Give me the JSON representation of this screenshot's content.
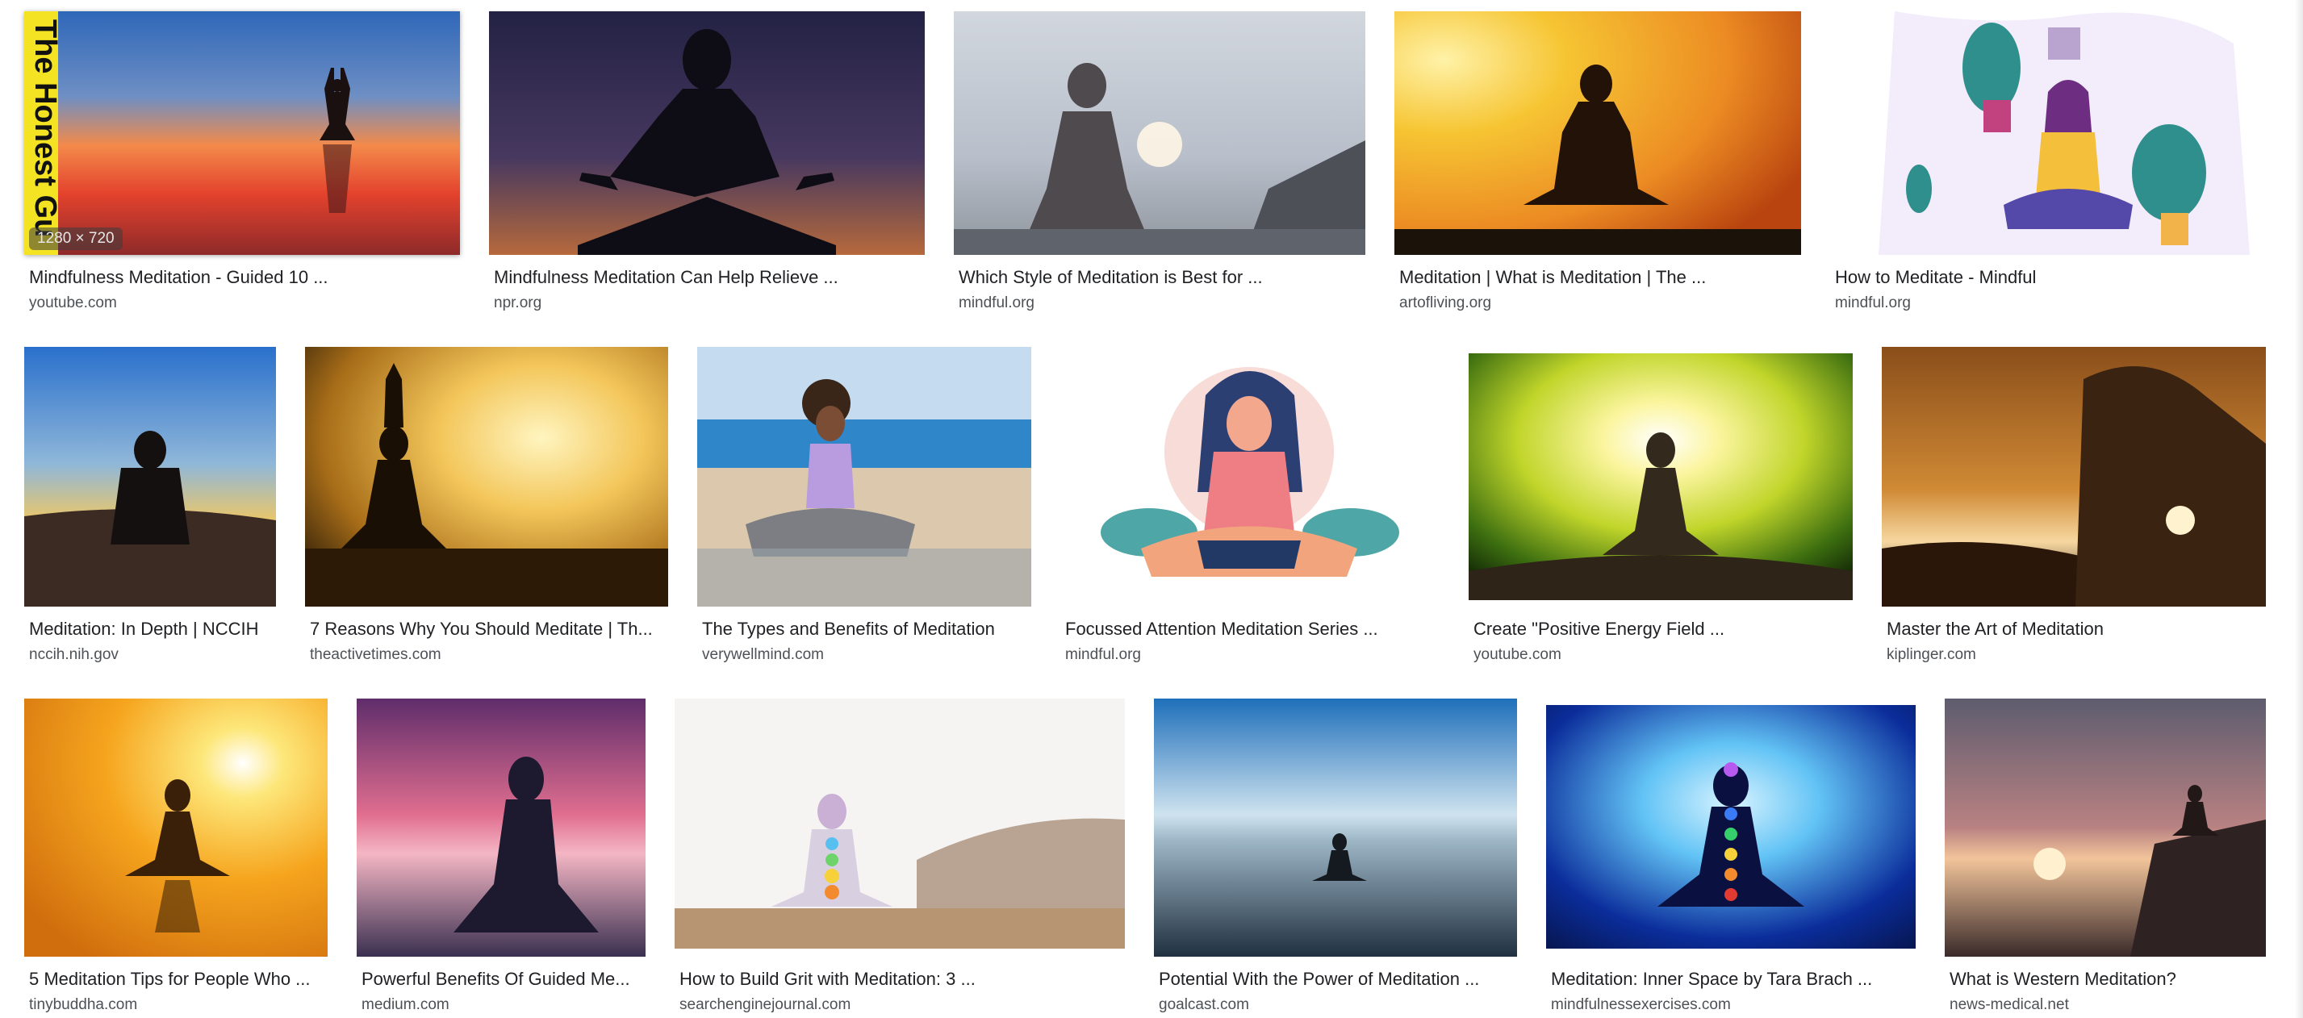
{
  "results": [
    {
      "title": "Mindfulness Meditation - Guided 10 ...",
      "source": "youtube.com",
      "dimensions": "1280 × 720",
      "overlay_text": "The Honest Gu",
      "palette": [
        "#3b6fb7",
        "#f18a4b",
        "#e2422e"
      ],
      "icon": "sitting-meditator-sunset-lake"
    },
    {
      "title": "Mindfulness Meditation Can Help Relieve ...",
      "source": "npr.org",
      "palette": [
        "#232244",
        "#4b3a62",
        "#a2613f"
      ],
      "icon": "silhouette-meditator"
    },
    {
      "title": "Which Style of Meditation is Best for ...",
      "source": "mindful.org",
      "palette": [
        "#c7cfd9",
        "#b9c0cb",
        "#5c6067"
      ],
      "icon": "woman-back-sea"
    },
    {
      "title": "Meditation | What is Meditation | The ...",
      "source": "artofliving.org",
      "palette": [
        "#f6c533",
        "#ec8b23",
        "#c74f12"
      ],
      "icon": "silhouette-meditator-sunrise"
    },
    {
      "title": "How to Meditate - Mindful",
      "source": "mindful.org",
      "palette": [
        "#ffffff",
        "#f3ecfb",
        "#7b4fa3"
      ],
      "icon": "illustration-woman-plants"
    },
    {
      "title": "Meditation: In Depth | NCCIH",
      "source": "nccih.nih.gov",
      "palette": [
        "#3b7fd4",
        "#f7c95b",
        "#2b2a2a"
      ],
      "icon": "man-back-sunset"
    },
    {
      "title": "7 Reasons Why You Should Meditate | Th...",
      "source": "theactivetimes.com",
      "palette": [
        "#f3c65a",
        "#bb7f1d",
        "#352309"
      ],
      "icon": "raised-arms-meditator"
    },
    {
      "title": "The Types and Benefits of Meditation",
      "source": "verywellmind.com",
      "palette": [
        "#b8d3ec",
        "#2f86c8",
        "#ddc9ae"
      ],
      "icon": "woman-beach-meditating"
    },
    {
      "title": "Focussed Attention Meditation Series ...",
      "source": "mindful.org",
      "palette": [
        "#ffffff",
        "#f4d5d3",
        "#4fa6a6"
      ],
      "icon": "illustration-woman-lotus"
    },
    {
      "title": "Create \"Positive Energy Field ...",
      "source": "youtube.com",
      "palette": [
        "#b6ce2a",
        "#f9f39c",
        "#2e2418"
      ],
      "icon": "meditator-energy-burst"
    },
    {
      "title": "Master the Art of Meditation",
      "source": "kiplinger.com",
      "palette": [
        "#c57e2d",
        "#8a4e1a",
        "#2d1a0c"
      ],
      "icon": "closeup-meditator-sunset"
    },
    {
      "title": "5 Meditation Tips for People Who ...",
      "source": "tinybuddha.com",
      "palette": [
        "#fcd33b",
        "#f6a51e",
        "#3a2008"
      ],
      "icon": "meditator-sun-reflection"
    },
    {
      "title": "Powerful Benefits Of Guided Me...",
      "source": "medium.com",
      "palette": [
        "#5f2d6b",
        "#e06e8f",
        "#1d1a30"
      ],
      "icon": "woman-sea-dusk"
    },
    {
      "title": "How to Build Grit with Meditation: 3 ...",
      "source": "searchenginejournal.com",
      "palette": [
        "#f6f4f2",
        "#b9a493",
        "#8d6b4a"
      ],
      "icon": "chakra-meditator-deck"
    },
    {
      "title": "Potential With the Power of Meditation ...",
      "source": "goalcast.com",
      "palette": [
        "#2f8fd3",
        "#cfe3ef",
        "#203040"
      ],
      "icon": "meditator-beach-sky"
    },
    {
      "title": "Meditation: Inner Space by Tara Brach ...",
      "source": "mindfulnessexercises.com",
      "palette": [
        "#0b2d9b",
        "#62c3f5",
        "#06144a"
      ],
      "icon": "chakra-figure-light-rays"
    },
    {
      "title": "What is Western Meditation?",
      "source": "news-medical.net",
      "palette": [
        "#5d5c6e",
        "#e19e71",
        "#3a2a2a"
      ],
      "icon": "woman-cliff-sunset"
    }
  ]
}
